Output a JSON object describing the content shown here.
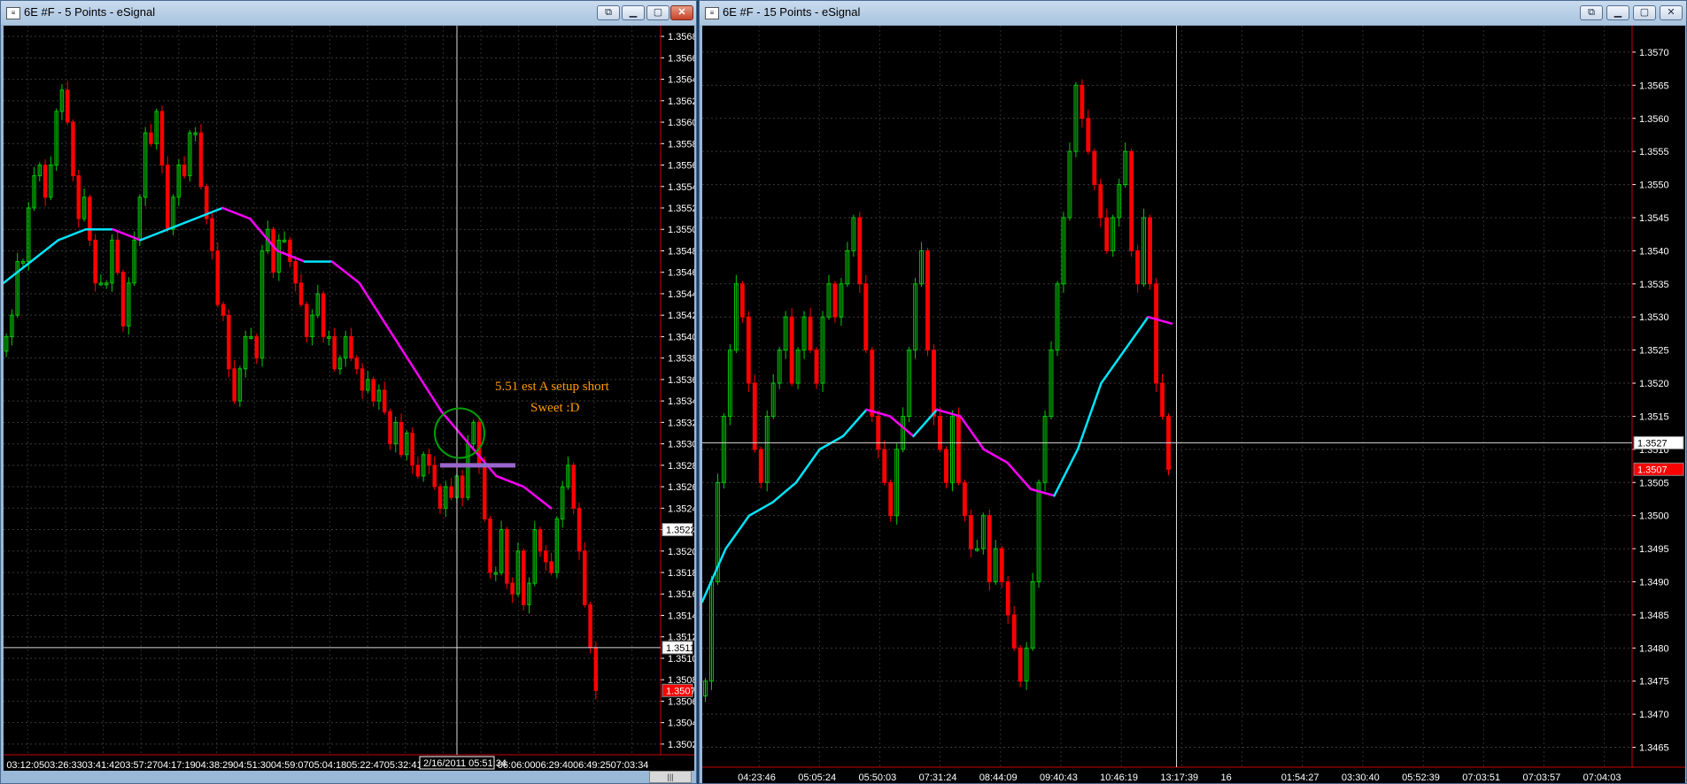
{
  "colors": {
    "up": "#00cc00",
    "down": "#ff0000",
    "ma_up": "#00e5ff",
    "ma_down": "#ff00ff",
    "axis_label": "#ffffff",
    "price_bg": "#ffffff",
    "last_bg": "#ff0000",
    "annotation": "#ff9900",
    "circle": "#00a000",
    "level_line": "#9966cc"
  },
  "window_left": {
    "title": "6E #F - 5 Points - eSignal",
    "y_axis": {
      "ticks": [
        "1.3568",
        "1.3566",
        "1.3564",
        "1.3562",
        "1.3560",
        "1.3558",
        "1.3556",
        "1.3554",
        "1.3552",
        "1.3550",
        "1.3548",
        "1.3546",
        "1.3544",
        "1.3542",
        "1.3540",
        "1.3538",
        "1.3536",
        "1.3534",
        "1.3532",
        "1.3530",
        "1.3528",
        "1.3526",
        "1.3524",
        "1.3522",
        "1.3520",
        "1.3518",
        "1.3516",
        "1.3514",
        "1.3512",
        "1.3510",
        "1.3508",
        "1.3506",
        "1.3504",
        "1.3502"
      ],
      "range": [
        1.3501,
        1.3569
      ]
    },
    "x_axis": {
      "ticks": [
        "03:12:05",
        "03:26:33",
        "03:41:42",
        "03:57:27",
        "04:17:19",
        "04:38:29",
        "04:51:30",
        "04:59:07",
        "05:04:18",
        "05:22:47",
        "05:32:41",
        "05:40",
        "37",
        "06:06:00",
        "06:29:40",
        "06:49:25",
        "07:03:34"
      ]
    },
    "cursor_time": "2/16/2011 05:51:34",
    "price_labels": {
      "cross": "1.3522",
      "cursor": "1.3511",
      "last": "1.3507"
    },
    "annotation": {
      "line1": "5.51 est A setup short",
      "line2": "Sweet :D"
    },
    "chart_data": {
      "type": "candlestick",
      "close_sequence": [
        1.354,
        1.3542,
        1.3547,
        1.3547,
        1.3552,
        1.3555,
        1.3556,
        1.3553,
        1.3556,
        1.3561,
        1.3563,
        1.356,
        1.3555,
        1.3551,
        1.3553,
        1.3549,
        1.3545,
        1.3545,
        1.3545,
        1.3549,
        1.3546,
        1.3541,
        1.3545,
        1.3549,
        1.3553,
        1.3559,
        1.3558,
        1.3561,
        1.3556,
        1.355,
        1.3553,
        1.3556,
        1.3555,
        1.3559,
        1.3559,
        1.3554,
        1.3551,
        1.3548,
        1.3543,
        1.3542,
        1.3537,
        1.3534,
        1.3537,
        1.354,
        1.354,
        1.3538,
        1.3548,
        1.355,
        1.3546,
        1.3549,
        1.3549,
        1.3547,
        1.3545,
        1.3543,
        1.354,
        1.3542,
        1.3544,
        1.354,
        1.354,
        1.3537,
        1.3538,
        1.354,
        1.3538,
        1.3537,
        1.3535,
        1.3536,
        1.3534,
        1.3535,
        1.3533,
        1.353,
        1.3532,
        1.3529,
        1.3531,
        1.3528,
        1.3527,
        1.3529,
        1.3528,
        1.3526,
        1.3524,
        1.3526,
        1.3525,
        1.3527,
        1.3525,
        1.353,
        1.3532,
        1.3528,
        1.3523,
        1.3518,
        1.3518,
        1.3522,
        1.3517,
        1.3516,
        1.352,
        1.3515,
        1.3517,
        1.3522,
        1.352,
        1.3519,
        1.3518,
        1.3523,
        1.3526,
        1.3528,
        1.3524,
        1.352,
        1.3515,
        1.3511,
        1.3507
      ],
      "ma": [
        1.3545,
        1.3547,
        1.3549,
        1.355,
        1.355,
        1.3549,
        1.355,
        1.3551,
        1.3552,
        1.3551,
        1.3548,
        1.3547,
        1.3547,
        1.3545,
        1.3541,
        1.3537,
        1.3533,
        1.353,
        1.3527,
        1.3526,
        1.3524
      ]
    }
  },
  "window_right": {
    "title": "6E #F - 15 Points - eSignal",
    "y_axis": {
      "ticks": [
        "1.3570",
        "1.3565",
        "1.3560",
        "1.3555",
        "1.3550",
        "1.3545",
        "1.3540",
        "1.3535",
        "1.3530",
        "1.3525",
        "1.3520",
        "1.3515",
        "1.3510",
        "1.3505",
        "1.3500",
        "1.3495",
        "1.3490",
        "1.3485",
        "1.3480",
        "1.3475",
        "1.3470",
        "1.3465"
      ],
      "range": [
        1.3462,
        1.3574
      ]
    },
    "x_axis": {
      "ticks": [
        "04:23:46",
        "05:05:24",
        "05:50:03",
        "07:31:24",
        "08:44:09",
        "09:40:43",
        "10:46:19",
        "13:17:39",
        "16",
        "01:54:27",
        "03:30:40",
        "05:52:39",
        "07:03:51",
        "07:03:57",
        "07:04:03"
      ]
    },
    "price_labels": {
      "cursor": "1.3527",
      "last": "1.3507"
    },
    "chart_data": {
      "type": "candlestick",
      "close_sequence": [
        1.3475,
        1.349,
        1.3505,
        1.3515,
        1.3525,
        1.3535,
        1.353,
        1.352,
        1.351,
        1.3505,
        1.3515,
        1.352,
        1.3525,
        1.353,
        1.352,
        1.3525,
        1.353,
        1.3525,
        1.352,
        1.353,
        1.3535,
        1.353,
        1.3535,
        1.354,
        1.3545,
        1.3535,
        1.3525,
        1.3515,
        1.351,
        1.3505,
        1.35,
        1.351,
        1.3515,
        1.3525,
        1.3535,
        1.354,
        1.3525,
        1.3515,
        1.351,
        1.3505,
        1.3515,
        1.3505,
        1.35,
        1.3495,
        1.3495,
        1.35,
        1.349,
        1.3495,
        1.349,
        1.3485,
        1.348,
        1.3475,
        1.348,
        1.349,
        1.3505,
        1.3515,
        1.3525,
        1.3535,
        1.3545,
        1.3555,
        1.3565,
        1.356,
        1.3555,
        1.355,
        1.3545,
        1.354,
        1.3545,
        1.355,
        1.3555,
        1.354,
        1.3535,
        1.3545,
        1.3535,
        1.352,
        1.3515,
        1.3507
      ],
      "ma": [
        1.3487,
        1.3495,
        1.35,
        1.3502,
        1.3505,
        1.351,
        1.3512,
        1.3516,
        1.3515,
        1.3512,
        1.3516,
        1.3515,
        1.351,
        1.3508,
        1.3504,
        1.3503,
        1.351,
        1.352,
        1.3525,
        1.353,
        1.3529
      ]
    }
  }
}
